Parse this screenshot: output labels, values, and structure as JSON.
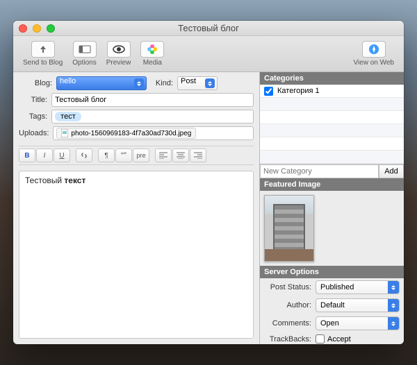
{
  "window": {
    "title": "Тестовый блог"
  },
  "toolbar": {
    "send": "Send to Blog",
    "options": "Options",
    "preview": "Preview",
    "media": "Media",
    "viewweb": "View on Web"
  },
  "form": {
    "blog_label": "Blog:",
    "blog_value": "hello",
    "kind_label": "Kind:",
    "kind_value": "Post",
    "title_label": "Title:",
    "title_value": "Тестовый блог",
    "tags_label": "Tags:",
    "tag_chip": "тест",
    "uploads_label": "Uploads:",
    "upload_file": "photo-1560969183-4f7a30ad730d.jpeg"
  },
  "format": {
    "bold": "B",
    "italic": "I",
    "underline": "U",
    "link": "link",
    "blockquote": "¶",
    "quote": "“”",
    "pre": "pre",
    "left": "al",
    "center": "ac",
    "right": "ar"
  },
  "editor": {
    "text_plain": "Тестовый ",
    "text_bold": "текст"
  },
  "cats": {
    "header": "Categories",
    "items": [
      "Категория 1"
    ],
    "checked": [
      true
    ],
    "newplaceholder": "New Category",
    "addbtn": "Add"
  },
  "featured": {
    "header": "Featured Image"
  },
  "server": {
    "header": "Server Options",
    "status_label": "Post Status:",
    "status_value": "Published",
    "author_label": "Author:",
    "author_value": "Default",
    "comments_label": "Comments:",
    "comments_value": "Open",
    "trackbacks_label": "TrackBacks:",
    "trackbacks_accept": "Accept"
  }
}
